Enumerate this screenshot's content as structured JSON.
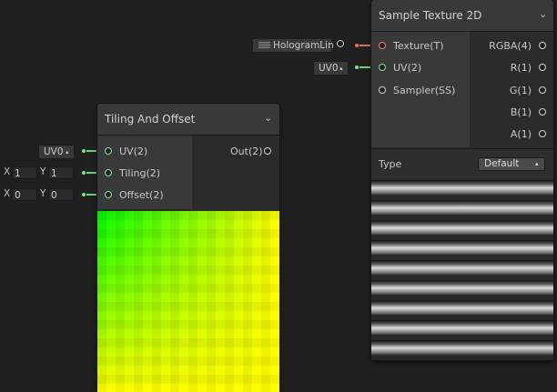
{
  "colors": {
    "canvas": "#202020",
    "vector_port": "#84e4a7",
    "texture_port": "#f0817a",
    "output_port": "#d6d6d6"
  },
  "tiling_node": {
    "title": "Tiling And Offset",
    "collapse_icon": "chevron-down-icon",
    "inputs": [
      {
        "label": "UV(2)"
      },
      {
        "label": "Tiling(2)"
      },
      {
        "label": "Offset(2)"
      }
    ],
    "outputs": [
      {
        "label": "Out(2)"
      }
    ],
    "uv_channel": "UV0",
    "tiling": {
      "x_label": "X",
      "x_value": "1",
      "y_label": "Y",
      "y_value": "1"
    },
    "offset": {
      "x_label": "X",
      "x_value": "0",
      "y_label": "Y",
      "y_value": "0"
    }
  },
  "sample_node": {
    "title": "Sample Texture 2D",
    "collapse_icon": "chevron-down-icon",
    "inputs": [
      {
        "label": "Texture(T)"
      },
      {
        "label": "UV(2)"
      },
      {
        "label": "Sampler(SS)"
      }
    ],
    "outputs": [
      {
        "label": "RGBA(4)"
      },
      {
        "label": "R(1)"
      },
      {
        "label": "G(1)"
      },
      {
        "label": "B(1)"
      },
      {
        "label": "A(1)"
      }
    ],
    "texture_value": "HologramLin",
    "uv_channel": "UV0",
    "type_label": "Type",
    "type_value": "Default"
  }
}
